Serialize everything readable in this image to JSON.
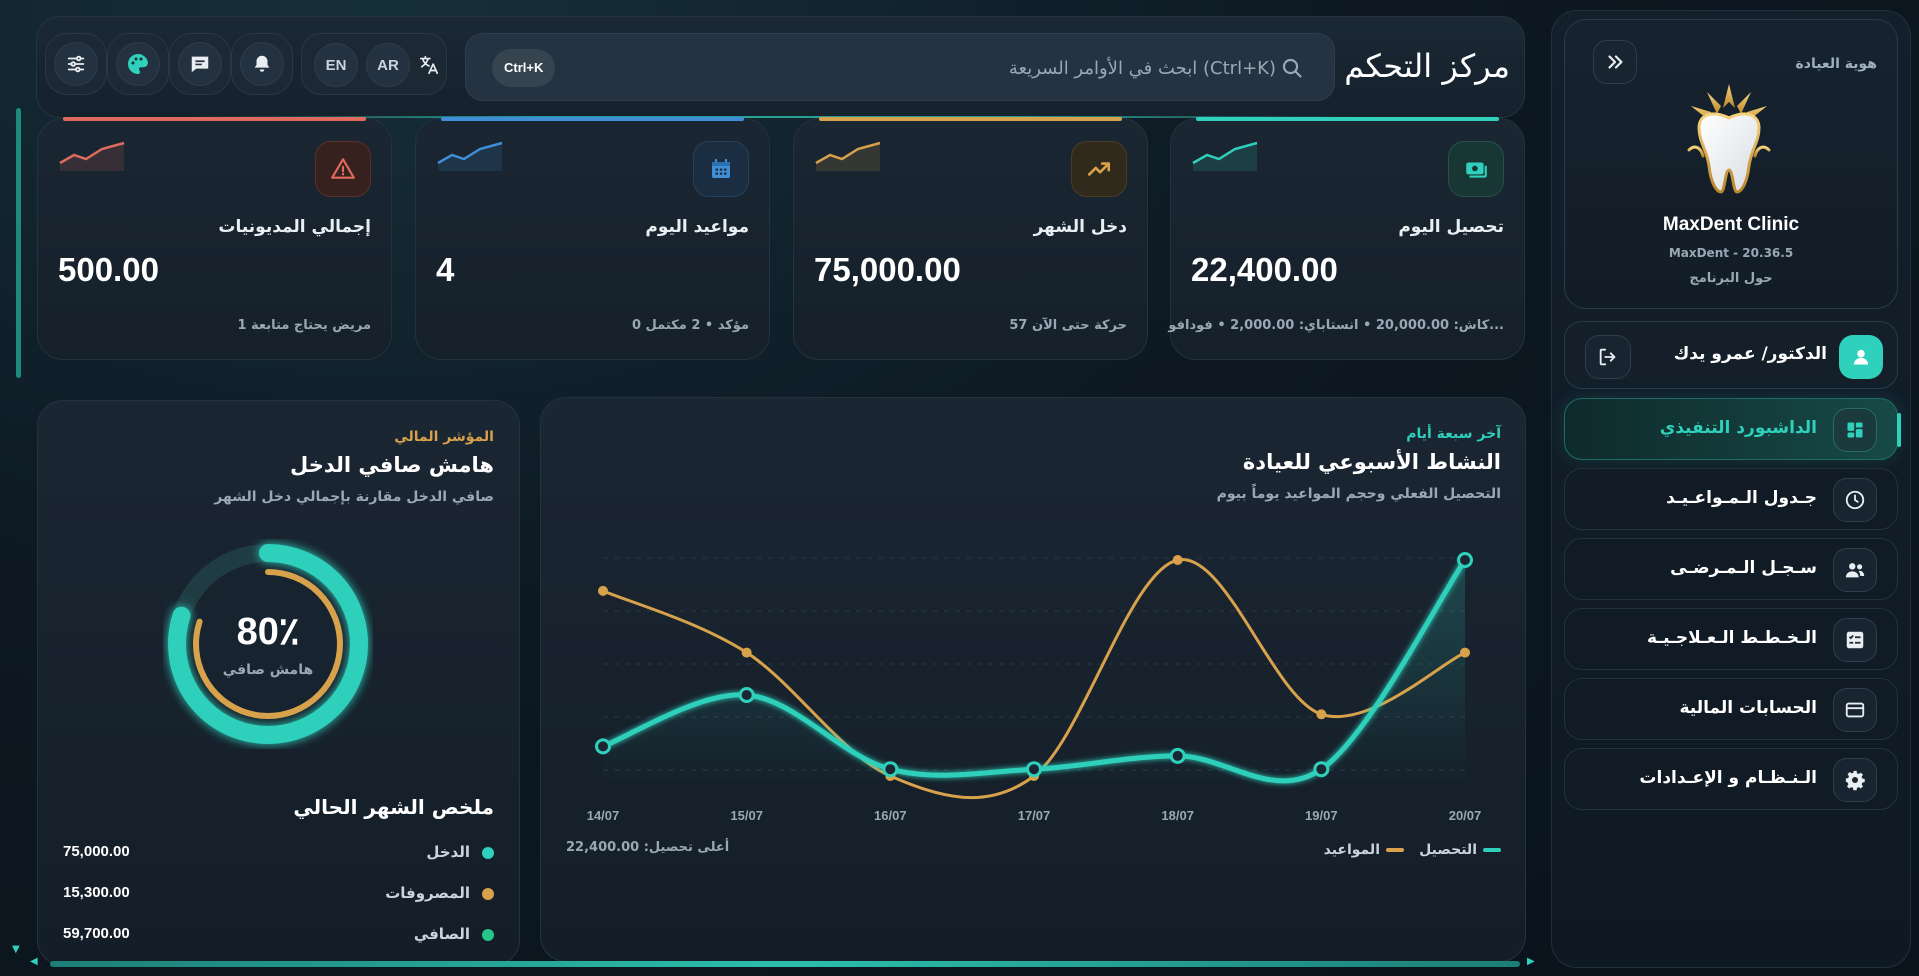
{
  "colors": {
    "teal": "#2fd0bc",
    "gold": "#d8a14b",
    "blue": "#3f8fd8",
    "red": "#e06b5d",
    "green": "#25c48a"
  },
  "sidebar": {
    "brand_label": "هوية العيادة",
    "brand_name": "MaxDent Clinic",
    "brand_version": "MaxDent - 20.36.5",
    "about": "حول البرنامج",
    "collapse_icon": "chevrons-right-icon",
    "user": {
      "name": "الدكتور/ عمرو يدك",
      "avatar_icon": "user-icon",
      "logout_icon": "logout-icon"
    },
    "nav": [
      {
        "label": "الداشبورد التنفيذي",
        "icon": "dashboard-icon",
        "active": true
      },
      {
        "label": "جـدول الـمـواعـيـد",
        "icon": "clock-icon",
        "active": false
      },
      {
        "label": "سـجـل الـمـرضـى",
        "icon": "users-icon",
        "active": false
      },
      {
        "label": "الـخـطـط الـعـلاجـيـة",
        "icon": "checklist-icon",
        "active": false
      },
      {
        "label": "الحسابات المالية",
        "icon": "credit-card-icon",
        "active": false
      },
      {
        "label": "الـنـظـام و الإعـدادات",
        "icon": "gear-icon",
        "active": false
      }
    ]
  },
  "topbar": {
    "title": "مركز التحكم",
    "search_placeholder": "ابحث في الأوامر السريعة (Ctrl+K)",
    "search_shortcut": "Ctrl+K",
    "lang_ar": "AR",
    "lang_en": "EN"
  },
  "stats": [
    {
      "label": "تحصيل اليوم",
      "value": "22,400.00",
      "sub": "كاش: 20,000.00 • انستاباي: 2,000.00 • فودافو...",
      "icon": "cash-icon",
      "accent": "#2fd0bc"
    },
    {
      "label": "دخل الشهر",
      "value": "75,000.00",
      "sub": "57 حركة حتى الآن",
      "icon": "trending-up-icon",
      "accent": "#d8a14b"
    },
    {
      "label": "مواعيد اليوم",
      "value": "4",
      "sub": "0 مؤكد • 2 مكتمل",
      "icon": "calendar-icon",
      "accent": "#3f8fd8"
    },
    {
      "label": "إجمالي المديونيات",
      "value": "500.00",
      "sub": "1 مريض يحتاج متابعة",
      "icon": "warning-icon",
      "accent": "#e06b5d"
    }
  ],
  "activity": {
    "eyebrow": "آخر سبعة أيام",
    "title": "النشاط الأسبوعي للعيادة",
    "subtitle": "التحصيل الفعلي وحجم المواعيد يوماً بيوم",
    "legend_collection": "التحصيل",
    "legend_appointments": "المواعيد",
    "peak_note": "أعلى تحصيل: 22,400.00"
  },
  "chart_data": {
    "type": "line",
    "categories": [
      "14/07",
      "15/07",
      "16/07",
      "17/07",
      "18/07",
      "19/07",
      "20/07"
    ],
    "series": [
      {
        "name": "التحصيل",
        "values": [
          2800,
          8200,
          400,
          400,
          1800,
          400,
          22400
        ]
      },
      {
        "name": "المواعيد",
        "values": [
          6,
          4,
          0,
          0,
          7,
          2,
          4
        ]
      }
    ],
    "grid": true,
    "legend": "bottom-right"
  },
  "margin": {
    "eyebrow": "المؤشر المالي",
    "title": "هامش صافي الدخل",
    "subtitle": "صافي الدخل مقارنة بإجمالي دخل الشهر",
    "gauge_text": "80٪",
    "gauge_percent": 80,
    "gauge_label": "هامش صافي",
    "summary_title": "ملخص الشهر الحالي",
    "summary": [
      {
        "label": "الدخل",
        "value": "75,000.00",
        "color": "#2fd0bc"
      },
      {
        "label": "المصروفات",
        "value": "15,300.00",
        "color": "#d8a14b"
      },
      {
        "label": "الصافي",
        "value": "59,700.00",
        "color": "#25c48a"
      }
    ]
  }
}
